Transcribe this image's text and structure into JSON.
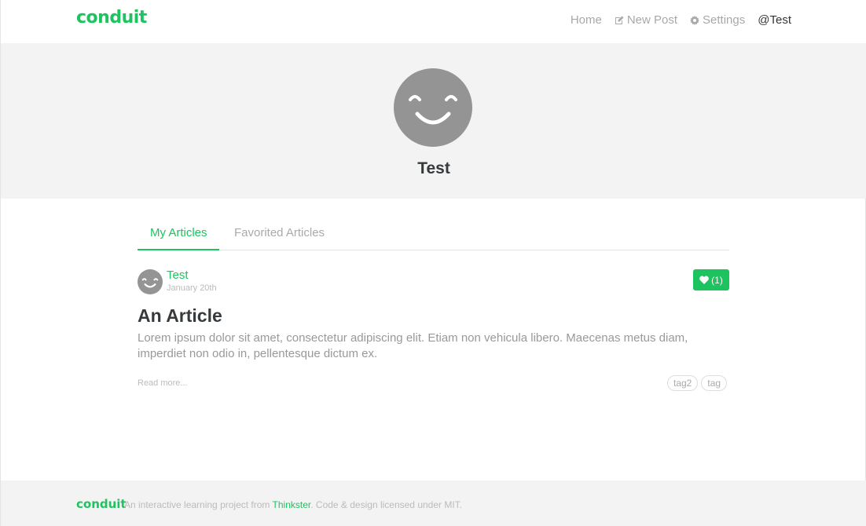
{
  "nav": {
    "brand": "conduit",
    "items": [
      {
        "label": "Home",
        "icon": ""
      },
      {
        "label": "New Post",
        "icon": "edit-icon"
      },
      {
        "label": "Settings",
        "icon": "gear-icon"
      },
      {
        "label": "@Test",
        "icon": ""
      }
    ]
  },
  "profile": {
    "username": "Test"
  },
  "tabs": [
    {
      "label": "My Articles",
      "active": true
    },
    {
      "label": "Favorited Articles",
      "active": false
    }
  ],
  "article": {
    "author": "Test",
    "date": "January 20th",
    "favorites": "(1)",
    "title": "An Article",
    "description": "Lorem ipsum dolor sit amet, consectetur adipiscing elit. Etiam non vehicula libero. Maecenas metus diam, imperdiet non odio in, pellentesque dictum ex.",
    "read_more": "Read more...",
    "tags": [
      "tag2",
      "tag"
    ]
  },
  "footer": {
    "brand": "conduit",
    "text_before": "An interactive learning project from ",
    "link": "Thinkster",
    "text_after": ". Code & design licensed under MIT."
  },
  "colors": {
    "accent": "#1cc35f",
    "banner_bg": "#f3f3f3",
    "avatar": "#949494"
  }
}
